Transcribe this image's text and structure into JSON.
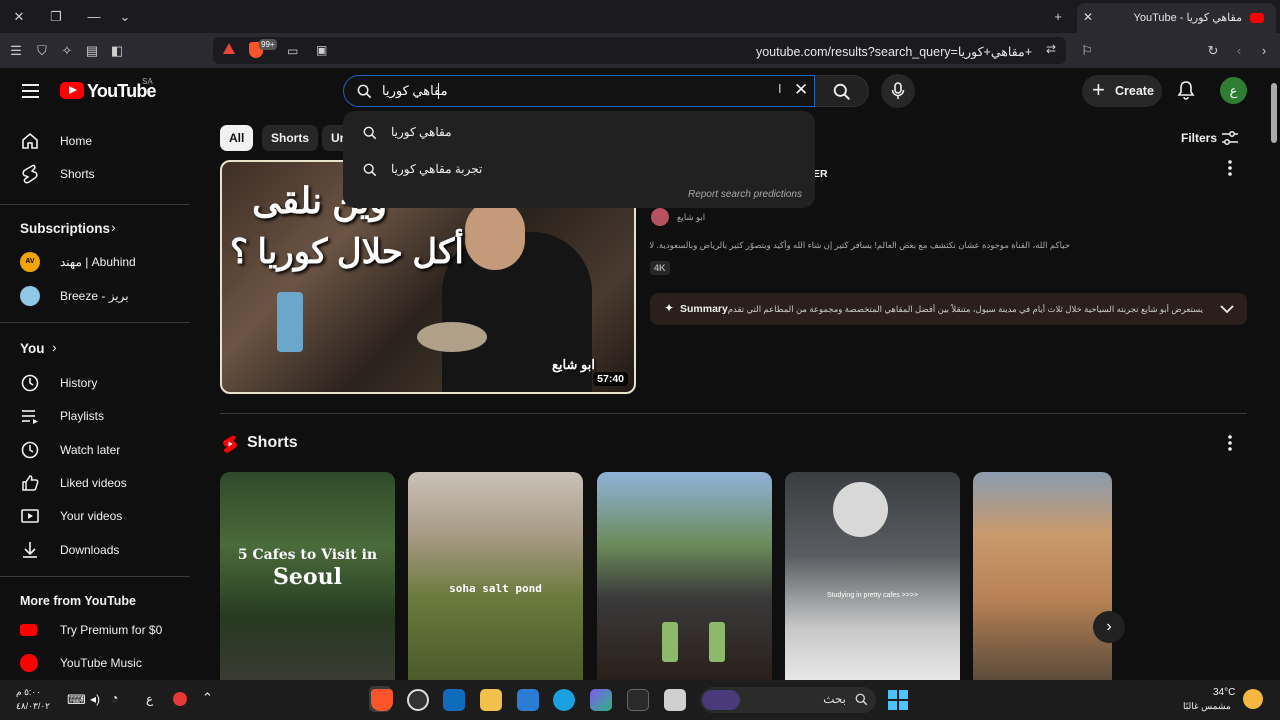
{
  "browser": {
    "tab_title": "مقاهي كوريا - YouTube",
    "url": "youtube.com/results?search_query=مقاهي+كوريا+",
    "notif_badge": "99+"
  },
  "masthead": {
    "logo_text": "YouTube",
    "country_code": "SA",
    "search_query": "مقاهي كوريا",
    "create_label": "Create",
    "avatar_letter": "ع"
  },
  "suggestions": {
    "items": [
      "مقاهي كوريا",
      "تجربة مقاهي كوريا"
    ],
    "report": "Report search predictions"
  },
  "sidebar": {
    "home": "Home",
    "shorts": "Shorts",
    "subscriptions": "Subscriptions",
    "subs": [
      "مهند | Abuhind",
      "Breeze - بريز"
    ],
    "you": "You",
    "you_items": [
      "History",
      "Playlists",
      "Watch later",
      "Liked videos",
      "Your videos",
      "Downloads"
    ],
    "more": "More from YouTube",
    "more_items": [
      "Try Premium for $0",
      "YouTube Music"
    ]
  },
  "chips": [
    "All",
    "Shorts",
    "Ur"
  ],
  "filters_label": "Filters",
  "video": {
    "title_fragment": "ER",
    "channel": "ابو شايع",
    "duration": "57:40",
    "thumb_text_1": "وين نلقى",
    "thumb_text_2": "أكل حلال كوريا ؟",
    "thumb_watermark": "ابو شايع",
    "description": "حياكم الله، القناة موجودة عشان نكتشف مع بعض العالم! بسافر كثير إن شاء الله وأكيد وبتصوّر كثير بالرياض وبالسعودية. لا تنسى ...",
    "badge": "4K",
    "summary_label": "Summary",
    "summary_text": "يستعرض أبو شايع تجربته السياحية خلال ثلاث أيام في مدينة سيول، متنقلاً بين أفضل المقاهي المتخصصة ومجموعة من المطاعم التي تقدم خيارات طعام..."
  },
  "shorts": {
    "title": "Shorts",
    "items": [
      {
        "caption": "5 Cafes to Visit in",
        "caption2": "Seoul"
      },
      {
        "caption": "soha salt pond",
        "caption2": ""
      },
      {
        "caption": "",
        "caption2": ""
      },
      {
        "caption": "Studying in pretty cafes >>>>",
        "caption2": ""
      },
      {
        "caption": "",
        "caption2": ""
      }
    ]
  },
  "taskbar": {
    "time": "٥:٠٠ م",
    "date": "٤٨/٠٣/٠٢",
    "lang": "ع",
    "search_placeholder": "بحث",
    "temperature": "34°C",
    "weather": "مشمس غالبًا"
  }
}
